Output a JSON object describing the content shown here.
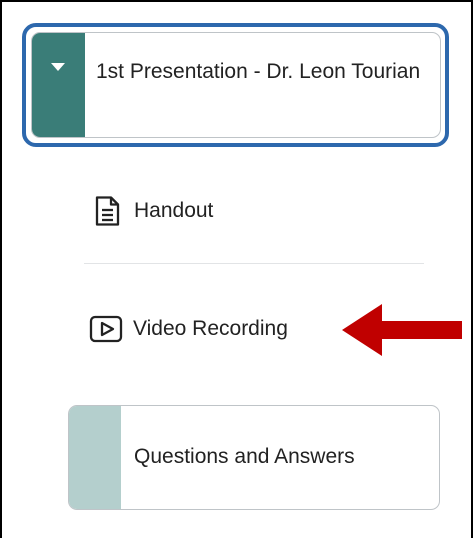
{
  "module": {
    "title": "1st Presentation - Dr. Leon Tourian",
    "expanded": true
  },
  "items": [
    {
      "label": "Handout",
      "icon": "document-icon"
    },
    {
      "label": "Video Recording",
      "icon": "video-play-icon"
    }
  ],
  "next_module": {
    "title": "Questions and Answers"
  },
  "annotation": {
    "icon": "red-arrow-icon"
  },
  "colors": {
    "focus_ring": "#2d68ad",
    "toggle_bg": "#3a7d78",
    "next_strip": "#b4cfcd",
    "arrow": "#c00000",
    "text": "#222222"
  }
}
